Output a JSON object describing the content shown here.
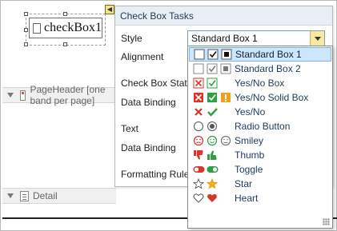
{
  "control": {
    "label": "checkBox1"
  },
  "bands": {
    "page_header": "PageHeader [one band per page]",
    "detail": "Detail"
  },
  "tasks": {
    "title": "Check Box Tasks",
    "rows": {
      "style": "Style",
      "alignment": "Alignment",
      "check_box_state": "Check Box State",
      "data_binding_1": "Data Binding",
      "text": "Text",
      "data_binding_2": "Data Binding",
      "formatting_rules": "Formatting Rules"
    }
  },
  "style_combo": {
    "value": "Standard Box 1"
  },
  "dropdown": {
    "items": [
      {
        "label": "Standard Box 1",
        "icon": "standard-box-1-icons",
        "selected": true
      },
      {
        "label": "Standard Box 2",
        "icon": "standard-box-2-icons",
        "selected": false
      },
      {
        "label": "Yes/No Box",
        "icon": "yes-no-box-icons",
        "selected": false
      },
      {
        "label": "Yes/No Solid Box",
        "icon": "yes-no-solid-box-icons",
        "selected": false
      },
      {
        "label": "Yes/No",
        "icon": "yes-no-icons",
        "selected": false
      },
      {
        "label": "Radio Button",
        "icon": "radio-button-icons",
        "selected": false
      },
      {
        "label": "Smiley",
        "icon": "smiley-icons",
        "selected": false
      },
      {
        "label": "Thumb",
        "icon": "thumb-icons",
        "selected": false
      },
      {
        "label": "Toggle",
        "icon": "toggle-icons",
        "selected": false
      },
      {
        "label": "Star",
        "icon": "star-icons",
        "selected": false
      },
      {
        "label": "Heart",
        "icon": "heart-icons",
        "selected": false
      }
    ]
  },
  "colors": {
    "accent_selected": "#cde6ff",
    "red": "#d9362b",
    "green": "#2ea043",
    "orange": "#f0a020"
  }
}
